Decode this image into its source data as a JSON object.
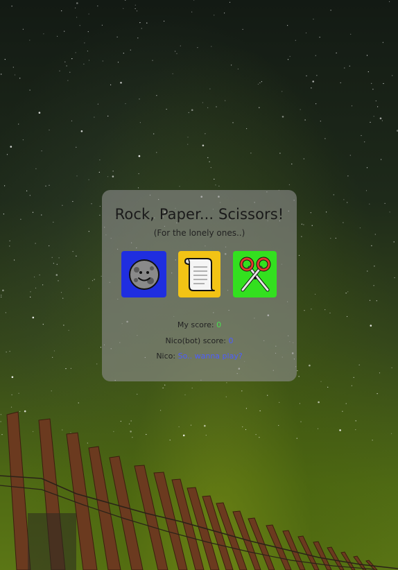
{
  "game": {
    "title": "Rock, Paper... Scissors!",
    "subtitle": "(For the lonely ones..)",
    "choices": [
      {
        "name": "rock",
        "icon": "moon-face-icon",
        "color": "#1f2ee0"
      },
      {
        "name": "paper",
        "icon": "scroll-icon",
        "color": "#f2c315"
      },
      {
        "name": "scissors",
        "icon": "scissors-icon",
        "color": "#33e01f"
      }
    ],
    "my_score_label": "My score:",
    "my_score_value": "0",
    "bot_score_label": "Nico(bot) score:",
    "bot_score_value": "0",
    "bot_name_label": "Nico:",
    "bot_message": "So.. wanna play?"
  },
  "colors": {
    "my_score": "#4be052",
    "bot_score": "#4d5cff",
    "card_bg": "rgba(140,140,140,0.62)"
  }
}
